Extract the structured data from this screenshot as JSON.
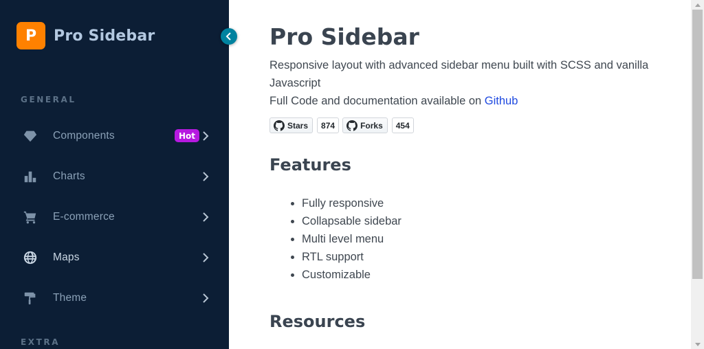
{
  "sidebar": {
    "brand": {
      "logo_letter": "P",
      "name": "Pro Sidebar",
      "logo_color": "#ff8100"
    },
    "collapse_icon": "chevron-left-icon",
    "sections": [
      {
        "title": "GENERAL"
      },
      {
        "title": "EXTRA"
      }
    ],
    "items": [
      {
        "label": "Components",
        "icon": "diamond-icon",
        "badge": "Hot"
      },
      {
        "label": "Charts",
        "icon": "bar-chart-icon"
      },
      {
        "label": "E-commerce",
        "icon": "cart-icon"
      },
      {
        "label": "Maps",
        "icon": "globe-icon",
        "active": true
      },
      {
        "label": "Theme",
        "icon": "paint-roller-icon"
      }
    ],
    "background_color": "#0c1e35",
    "badge_color": "#b619e0"
  },
  "main": {
    "title": "Pro Sidebar",
    "intro_line_1": "Responsive layout with advanced sidebar menu built with SCSS and vanilla Javascript",
    "intro_line_2_prefix": "Full Code and documentation available on ",
    "intro_link": "Github",
    "github": {
      "stars_label": "Stars",
      "stars_count": "874",
      "forks_label": "Forks",
      "forks_count": "454"
    },
    "features_heading": "Features",
    "features": [
      "Fully responsive",
      "Collapsable sidebar",
      "Multi level menu",
      "RTL support",
      "Customizable"
    ],
    "resources_heading": "Resources"
  }
}
